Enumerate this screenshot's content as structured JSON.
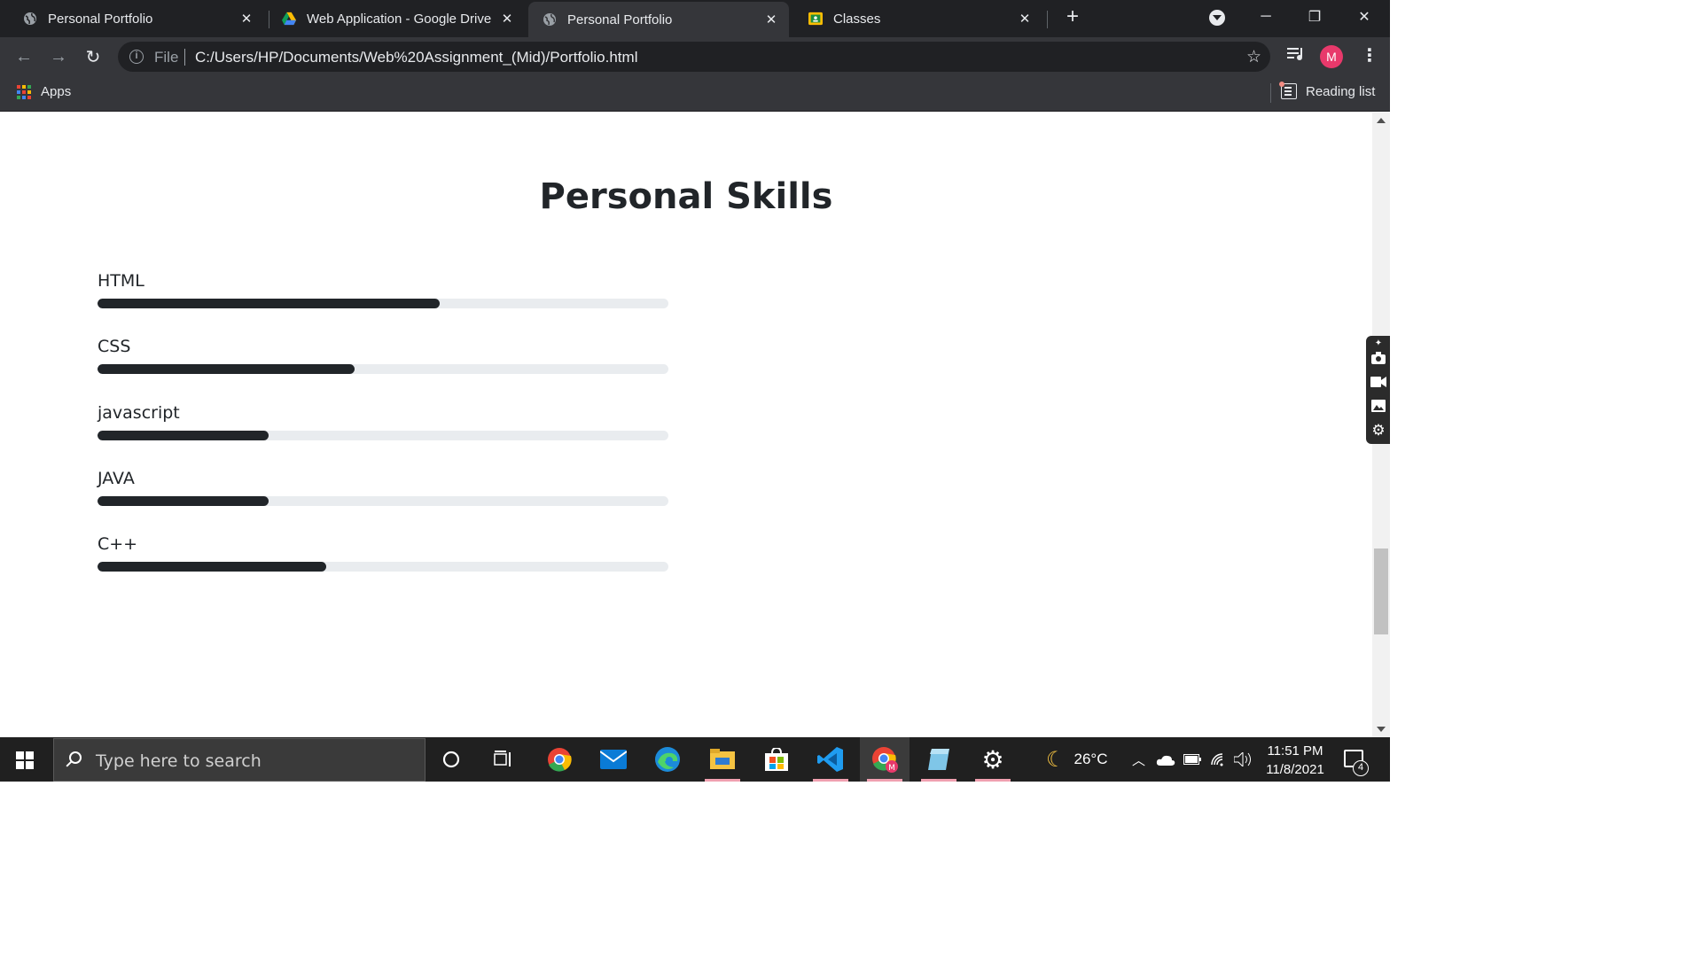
{
  "browser": {
    "tabs": [
      {
        "title": "Personal Portfolio",
        "active": false
      },
      {
        "title": "Web Application - Google Drive",
        "active": false
      },
      {
        "title": "Personal Portfolio",
        "active": true
      },
      {
        "title": "Classes",
        "active": false
      }
    ],
    "address": {
      "scheme_label": "File",
      "url": "C:/Users/HP/Documents/Web%20Assignment_(Mid)/Portfolio.html"
    },
    "profile_initial": "M",
    "bookmarks": {
      "apps_label": "Apps",
      "reading_list_label": "Reading list"
    }
  },
  "page": {
    "title": "Personal Skills",
    "skills": [
      {
        "name": "HTML",
        "percent": 60
      },
      {
        "name": "CSS",
        "percent": 45
      },
      {
        "name": "javascript",
        "percent": 30
      },
      {
        "name": "JAVA",
        "percent": 30
      },
      {
        "name": "C++",
        "percent": 40
      }
    ]
  },
  "taskbar": {
    "search_placeholder": "Type here to search",
    "weather": "26°C",
    "time": "11:51 PM",
    "date": "11/8/2021",
    "notification_count": "4"
  },
  "colors": {
    "progress_fill": "#212529",
    "progress_track": "#e9ecef",
    "chrome_dark": "#202124",
    "chrome_toolbar": "#35363a",
    "avatar": "#e8396b"
  },
  "icons": [
    "globe-icon",
    "google-drive-icon",
    "classroom-icon",
    "close-icon",
    "new-tab-icon",
    "tab-search-icon",
    "minimize-icon",
    "restore-icon",
    "window-close-icon",
    "back-icon",
    "forward-icon",
    "reload-icon",
    "info-icon",
    "star-icon",
    "media-queue-icon",
    "menu-icon",
    "apps-grid-icon",
    "reading-list-icon",
    "camera-icon",
    "video-icon",
    "gallery-icon",
    "settings-icon",
    "windows-start-icon",
    "search-icon",
    "cortana-icon",
    "task-view-icon",
    "chrome-icon",
    "mail-icon",
    "edge-icon",
    "file-explorer-icon",
    "store-icon",
    "vscode-icon",
    "notepad-icon",
    "weather-moon-icon",
    "notification-icon"
  ]
}
